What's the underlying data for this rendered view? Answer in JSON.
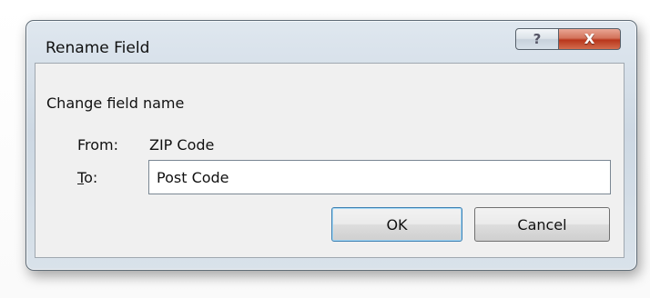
{
  "window": {
    "title": "Rename Field",
    "help_icon": "help-question-icon",
    "close_icon": "close-x-icon",
    "help_glyph": "?",
    "close_glyph": "X"
  },
  "content": {
    "heading": "Change field name",
    "from_label": "From:",
    "from_value": "ZIP Code",
    "to_label_accel": "T",
    "to_label_rest": "o:",
    "to_value": "Post Code"
  },
  "buttons": {
    "ok_label": "OK",
    "cancel_label": "Cancel"
  },
  "colors": {
    "close_button": "#c9462a",
    "default_button_border": "#3c7fb1"
  }
}
